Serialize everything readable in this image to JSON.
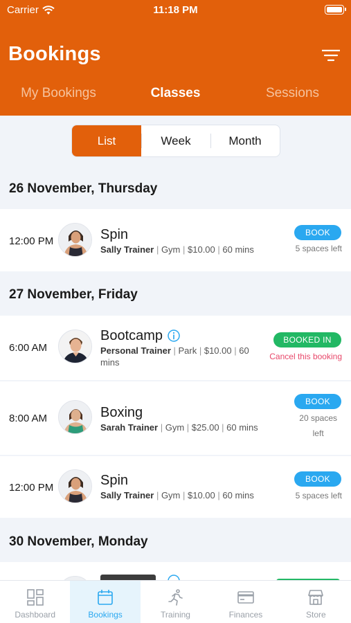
{
  "status": {
    "carrier": "Carrier",
    "time": "11:18 PM"
  },
  "header": {
    "title": "Bookings",
    "tabs": [
      {
        "label": "My Bookings",
        "active": false
      },
      {
        "label": "Classes",
        "active": true
      },
      {
        "label": "Sessions",
        "active": false
      }
    ]
  },
  "view_toggle": {
    "options": [
      "List",
      "Week",
      "Month"
    ],
    "selected": "List"
  },
  "days": [
    {
      "label": "26 November, Thursday",
      "classes": [
        {
          "time": "12:00 PM",
          "name": "Spin",
          "trainer": "Sally Trainer",
          "location": "Gym",
          "price": "$10.00",
          "duration": "60 mins",
          "action": "BOOK",
          "spaces": "5 spaces left"
        }
      ]
    },
    {
      "label": "27 November, Friday",
      "classes": [
        {
          "time": "6:00 AM",
          "name": "Bootcamp",
          "trainer": "Personal Trainer",
          "location": "Park",
          "price": "$10.00",
          "duration": "60",
          "duration_cont": "mins",
          "status": "BOOKED IN",
          "cancel": "Cancel this booking"
        },
        {
          "time": "8:00 AM",
          "name": "Boxing",
          "trainer": "Sarah Trainer",
          "location": "Gym",
          "price": "$25.00",
          "duration": "60 mins",
          "action": "BOOK",
          "spaces_line1": "20 spaces",
          "spaces_line2": "left"
        },
        {
          "time": "12:00 PM",
          "name": "Spin",
          "trainer": "Sally Trainer",
          "location": "Gym",
          "price": "$10.00",
          "duration": "60 mins",
          "action": "BOOK",
          "spaces": "5 spaces left"
        }
      ]
    },
    {
      "label": "30 November, Monday"
    }
  ],
  "separator": " | ",
  "nav": [
    {
      "label": "Dashboard",
      "icon": "dashboard-icon",
      "active": false
    },
    {
      "label": "Bookings",
      "icon": "calendar-icon",
      "active": true
    },
    {
      "label": "Training",
      "icon": "running-icon",
      "active": false
    },
    {
      "label": "Finances",
      "icon": "card-icon",
      "active": false
    },
    {
      "label": "Store",
      "icon": "store-icon",
      "active": false
    }
  ],
  "colors": {
    "primary": "#e2600b",
    "book": "#2aa8f0",
    "booked": "#22b864",
    "cancel": "#e8486a"
  }
}
